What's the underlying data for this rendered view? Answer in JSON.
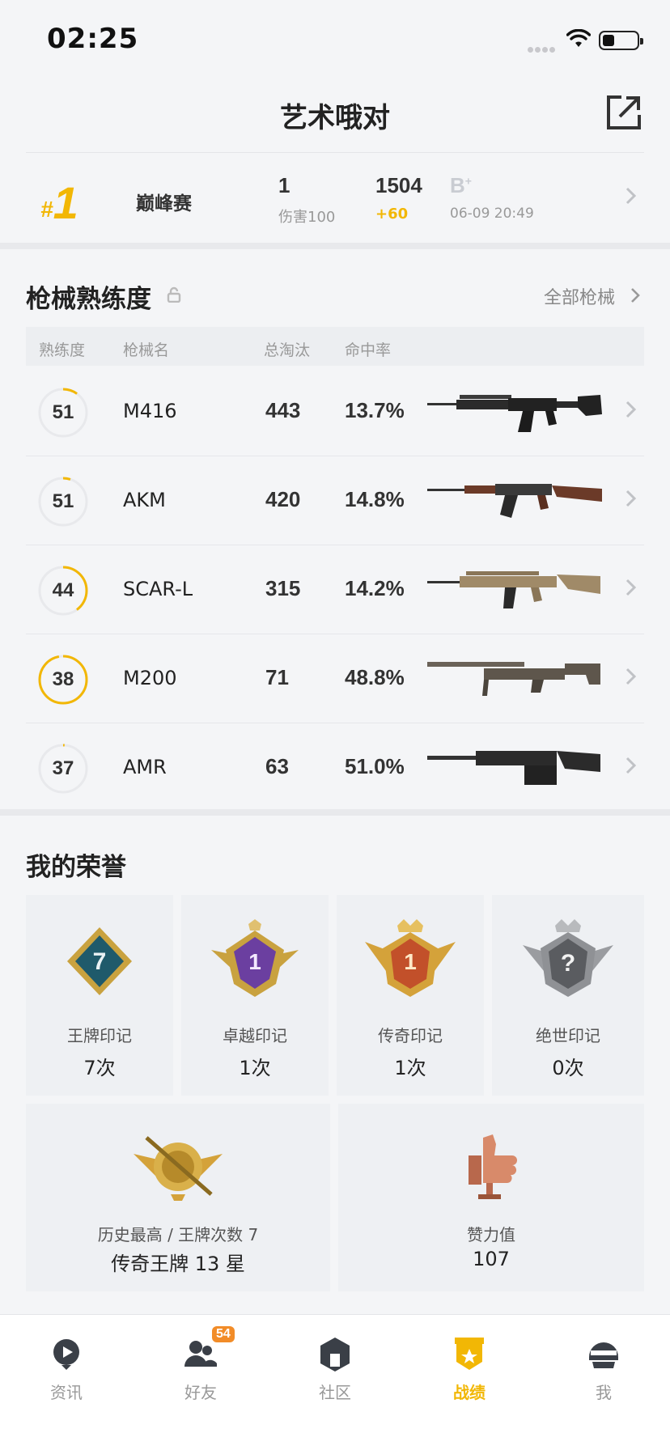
{
  "status_bar": {
    "time": "02:25"
  },
  "header": {
    "title": "艺术哦对"
  },
  "match": {
    "rank": "1",
    "rank_prefix": "#",
    "mode": "巅峰赛",
    "stat_value": "1",
    "stat_label": "伤害100",
    "score": "1504",
    "score_change": "+60",
    "grade": "B",
    "grade_plus": "+",
    "datetime": "06-09 20:49"
  },
  "weapons": {
    "title": "枪械熟练度",
    "all_label": "全部枪械",
    "columns": [
      "熟练度",
      "枪械名",
      "总淘汰",
      "命中率"
    ],
    "rows": [
      {
        "level": "51",
        "name": "M416",
        "kills": "443",
        "accuracy": "13.7%",
        "progress": 0.1
      },
      {
        "level": "51",
        "name": "AKM",
        "kills": "420",
        "accuracy": "14.8%",
        "progress": 0.05
      },
      {
        "level": "44",
        "name": "SCAR-L",
        "kills": "315",
        "accuracy": "14.2%",
        "progress": 0.4
      },
      {
        "level": "38",
        "name": "M200",
        "kills": "71",
        "accuracy": "48.8%",
        "progress": 0.97
      },
      {
        "level": "37",
        "name": "AMR",
        "kills": "63",
        "accuracy": "51.0%",
        "progress": 0.01
      }
    ]
  },
  "honors": {
    "title": "我的荣誉",
    "items": [
      {
        "label": "王牌印记",
        "count": "7次",
        "badge_text": "7"
      },
      {
        "label": "卓越印记",
        "count": "1次",
        "badge_text": "1"
      },
      {
        "label": "传奇印记",
        "count": "1次",
        "badge_text": "1"
      },
      {
        "label": "绝世印记",
        "count": "0次",
        "badge_text": "?"
      }
    ],
    "highest": {
      "label": "历史最高 / 王牌次数 7",
      "value": "传奇王牌 13 星"
    },
    "likes": {
      "label": "赞力值",
      "value": "107"
    }
  },
  "tabs": [
    {
      "label": "资讯",
      "icon": "news-icon",
      "active": false
    },
    {
      "label": "好友",
      "icon": "friends-icon",
      "active": false,
      "badge": "54"
    },
    {
      "label": "社区",
      "icon": "community-icon",
      "active": false
    },
    {
      "label": "战绩",
      "icon": "records-icon",
      "active": true
    },
    {
      "label": "我",
      "icon": "profile-icon",
      "active": false
    }
  ],
  "colors": {
    "accent": "#f2b705",
    "badge": "#f28c28"
  }
}
